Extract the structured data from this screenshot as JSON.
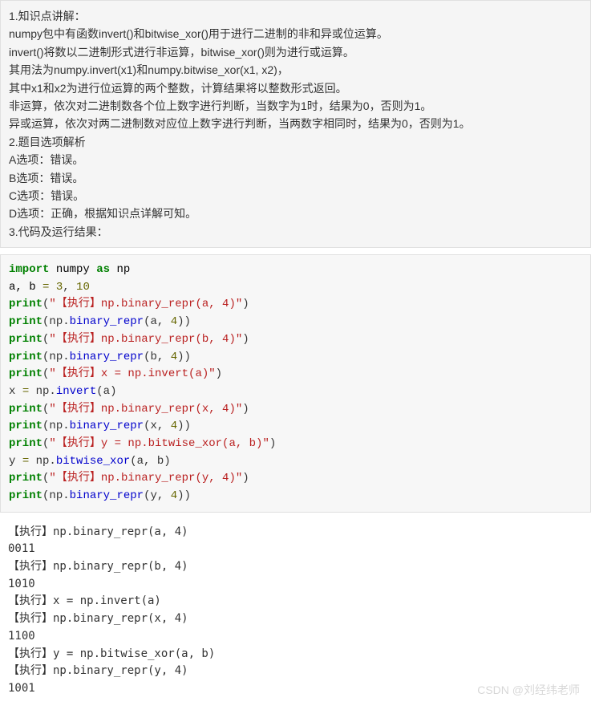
{
  "explanation": {
    "line1": "1.知识点讲解：",
    "line2": "numpy包中有函数invert()和bitwise_xor()用于进行二进制的非和异或位运算。",
    "line3": "invert()将数以二进制形式进行非运算，bitwise_xor()则为进行或运算。",
    "line4": "其用法为numpy.invert(x1)和numpy.bitwise_xor(x1, x2)，",
    "line5": "其中x1和x2为进行位运算的两个整数，计算结果将以整数形式返回。",
    "line6": "非运算，依次对二进制数各个位上数字进行判断，当数字为1时，结果为0，否则为1。",
    "line7": "异或运算，依次对两二进制数对应位上数字进行判断，当两数字相同时，结果为0，否则为1。",
    "blank1": "",
    "line8": "2.题目选项解析",
    "line9": "A选项：错误。",
    "line10": "B选项：错误。",
    "line11": "C选项：错误。",
    "line12": "D选项：正确，根据知识点详解可知。",
    "blank2": "",
    "line13": "3.代码及运行结果："
  },
  "code": {
    "l1": {
      "kw1": "import",
      "sp1": " ",
      "id1": "numpy",
      "sp2": " ",
      "kw2": "as",
      "sp3": " ",
      "id2": "np"
    },
    "l2": {
      "t1": "a, b ",
      "op": "=",
      "t2": " ",
      "n1": "3",
      "t3": ", ",
      "n2": "10"
    },
    "l3": {
      "fn": "print",
      "lp": "(",
      "str": "\"【执行】np.binary_repr(a, 4)\"",
      "rp": ")"
    },
    "l4": {
      "fn": "print",
      "lp": "(",
      "t1": "np.",
      "fn2": "binary_repr",
      "lp2": "(",
      "a1": "a, ",
      "n": "4",
      "rp2": ")",
      "rp": ")"
    },
    "l5": {
      "fn": "print",
      "lp": "(",
      "str": "\"【执行】np.binary_repr(b, 4)\"",
      "rp": ")"
    },
    "l6": {
      "fn": "print",
      "lp": "(",
      "t1": "np.",
      "fn2": "binary_repr",
      "lp2": "(",
      "a1": "b, ",
      "n": "4",
      "rp2": ")",
      "rp": ")"
    },
    "l7": {
      "fn": "print",
      "lp": "(",
      "str": "\"【执行】x = np.invert(a)\"",
      "rp": ")"
    },
    "l8": {
      "t1": "x ",
      "op": "=",
      "t2": " np.",
      "fn": "invert",
      "lp": "(",
      "a1": "a",
      "rp": ")"
    },
    "l9": {
      "fn": "print",
      "lp": "(",
      "str": "\"【执行】np.binary_repr(x, 4)\"",
      "rp": ")"
    },
    "l10": {
      "fn": "print",
      "lp": "(",
      "t1": "np.",
      "fn2": "binary_repr",
      "lp2": "(",
      "a1": "x, ",
      "n": "4",
      "rp2": ")",
      "rp": ")"
    },
    "l11": {
      "fn": "print",
      "lp": "(",
      "str": "\"【执行】y = np.bitwise_xor(a, b)\"",
      "rp": ")"
    },
    "l12": {
      "t1": "y ",
      "op": "=",
      "t2": " np.",
      "fn": "bitwise_xor",
      "lp": "(",
      "a1": "a, b",
      "rp": ")"
    },
    "l13": {
      "fn": "print",
      "lp": "(",
      "str": "\"【执行】np.binary_repr(y, 4)\"",
      "rp": ")"
    },
    "l14": {
      "fn": "print",
      "lp": "(",
      "t1": "np.",
      "fn2": "binary_repr",
      "lp2": "(",
      "a1": "y, ",
      "n": "4",
      "rp2": ")",
      "rp": ")"
    }
  },
  "output": {
    "o1": "【执行】np.binary_repr(a, 4)",
    "o2": "0011",
    "o3": "【执行】np.binary_repr(b, 4)",
    "o4": "1010",
    "o5": "【执行】x = np.invert(a)",
    "o6": "【执行】np.binary_repr(x, 4)",
    "o7": "1100",
    "o8": "【执行】y = np.bitwise_xor(a, b)",
    "o9": "【执行】np.binary_repr(y, 4)",
    "o10": "1001"
  },
  "watermark": "CSDN @刘经纬老师"
}
